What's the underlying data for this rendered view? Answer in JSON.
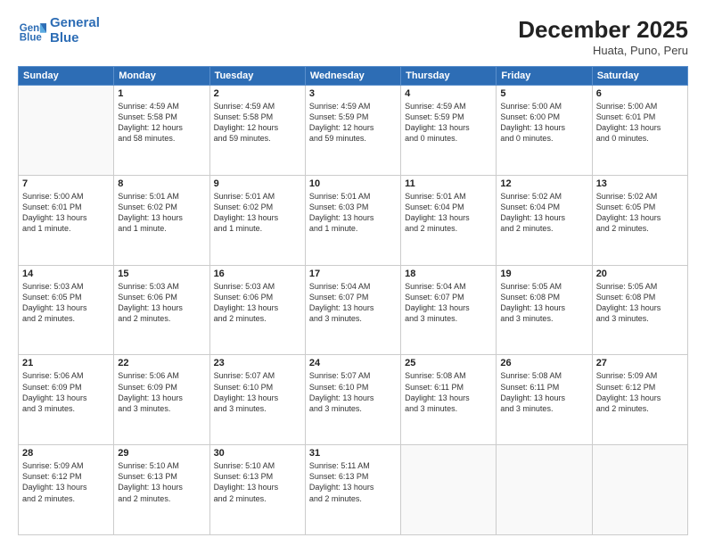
{
  "logo": {
    "line1": "General",
    "line2": "Blue"
  },
  "title": "December 2025",
  "location": "Huata, Puno, Peru",
  "days_header": [
    "Sunday",
    "Monday",
    "Tuesday",
    "Wednesday",
    "Thursday",
    "Friday",
    "Saturday"
  ],
  "weeks": [
    [
      {
        "day": "",
        "info": ""
      },
      {
        "day": "1",
        "info": "Sunrise: 4:59 AM\nSunset: 5:58 PM\nDaylight: 12 hours\nand 58 minutes."
      },
      {
        "day": "2",
        "info": "Sunrise: 4:59 AM\nSunset: 5:58 PM\nDaylight: 12 hours\nand 59 minutes."
      },
      {
        "day": "3",
        "info": "Sunrise: 4:59 AM\nSunset: 5:59 PM\nDaylight: 12 hours\nand 59 minutes."
      },
      {
        "day": "4",
        "info": "Sunrise: 4:59 AM\nSunset: 5:59 PM\nDaylight: 13 hours\nand 0 minutes."
      },
      {
        "day": "5",
        "info": "Sunrise: 5:00 AM\nSunset: 6:00 PM\nDaylight: 13 hours\nand 0 minutes."
      },
      {
        "day": "6",
        "info": "Sunrise: 5:00 AM\nSunset: 6:01 PM\nDaylight: 13 hours\nand 0 minutes."
      }
    ],
    [
      {
        "day": "7",
        "info": "Sunrise: 5:00 AM\nSunset: 6:01 PM\nDaylight: 13 hours\nand 1 minute."
      },
      {
        "day": "8",
        "info": "Sunrise: 5:01 AM\nSunset: 6:02 PM\nDaylight: 13 hours\nand 1 minute."
      },
      {
        "day": "9",
        "info": "Sunrise: 5:01 AM\nSunset: 6:02 PM\nDaylight: 13 hours\nand 1 minute."
      },
      {
        "day": "10",
        "info": "Sunrise: 5:01 AM\nSunset: 6:03 PM\nDaylight: 13 hours\nand 1 minute."
      },
      {
        "day": "11",
        "info": "Sunrise: 5:01 AM\nSunset: 6:04 PM\nDaylight: 13 hours\nand 2 minutes."
      },
      {
        "day": "12",
        "info": "Sunrise: 5:02 AM\nSunset: 6:04 PM\nDaylight: 13 hours\nand 2 minutes."
      },
      {
        "day": "13",
        "info": "Sunrise: 5:02 AM\nSunset: 6:05 PM\nDaylight: 13 hours\nand 2 minutes."
      }
    ],
    [
      {
        "day": "14",
        "info": "Sunrise: 5:03 AM\nSunset: 6:05 PM\nDaylight: 13 hours\nand 2 minutes."
      },
      {
        "day": "15",
        "info": "Sunrise: 5:03 AM\nSunset: 6:06 PM\nDaylight: 13 hours\nand 2 minutes."
      },
      {
        "day": "16",
        "info": "Sunrise: 5:03 AM\nSunset: 6:06 PM\nDaylight: 13 hours\nand 2 minutes."
      },
      {
        "day": "17",
        "info": "Sunrise: 5:04 AM\nSunset: 6:07 PM\nDaylight: 13 hours\nand 3 minutes."
      },
      {
        "day": "18",
        "info": "Sunrise: 5:04 AM\nSunset: 6:07 PM\nDaylight: 13 hours\nand 3 minutes."
      },
      {
        "day": "19",
        "info": "Sunrise: 5:05 AM\nSunset: 6:08 PM\nDaylight: 13 hours\nand 3 minutes."
      },
      {
        "day": "20",
        "info": "Sunrise: 5:05 AM\nSunset: 6:08 PM\nDaylight: 13 hours\nand 3 minutes."
      }
    ],
    [
      {
        "day": "21",
        "info": "Sunrise: 5:06 AM\nSunset: 6:09 PM\nDaylight: 13 hours\nand 3 minutes."
      },
      {
        "day": "22",
        "info": "Sunrise: 5:06 AM\nSunset: 6:09 PM\nDaylight: 13 hours\nand 3 minutes."
      },
      {
        "day": "23",
        "info": "Sunrise: 5:07 AM\nSunset: 6:10 PM\nDaylight: 13 hours\nand 3 minutes."
      },
      {
        "day": "24",
        "info": "Sunrise: 5:07 AM\nSunset: 6:10 PM\nDaylight: 13 hours\nand 3 minutes."
      },
      {
        "day": "25",
        "info": "Sunrise: 5:08 AM\nSunset: 6:11 PM\nDaylight: 13 hours\nand 3 minutes."
      },
      {
        "day": "26",
        "info": "Sunrise: 5:08 AM\nSunset: 6:11 PM\nDaylight: 13 hours\nand 3 minutes."
      },
      {
        "day": "27",
        "info": "Sunrise: 5:09 AM\nSunset: 6:12 PM\nDaylight: 13 hours\nand 2 minutes."
      }
    ],
    [
      {
        "day": "28",
        "info": "Sunrise: 5:09 AM\nSunset: 6:12 PM\nDaylight: 13 hours\nand 2 minutes."
      },
      {
        "day": "29",
        "info": "Sunrise: 5:10 AM\nSunset: 6:13 PM\nDaylight: 13 hours\nand 2 minutes."
      },
      {
        "day": "30",
        "info": "Sunrise: 5:10 AM\nSunset: 6:13 PM\nDaylight: 13 hours\nand 2 minutes."
      },
      {
        "day": "31",
        "info": "Sunrise: 5:11 AM\nSunset: 6:13 PM\nDaylight: 13 hours\nand 2 minutes."
      },
      {
        "day": "",
        "info": ""
      },
      {
        "day": "",
        "info": ""
      },
      {
        "day": "",
        "info": ""
      }
    ]
  ]
}
